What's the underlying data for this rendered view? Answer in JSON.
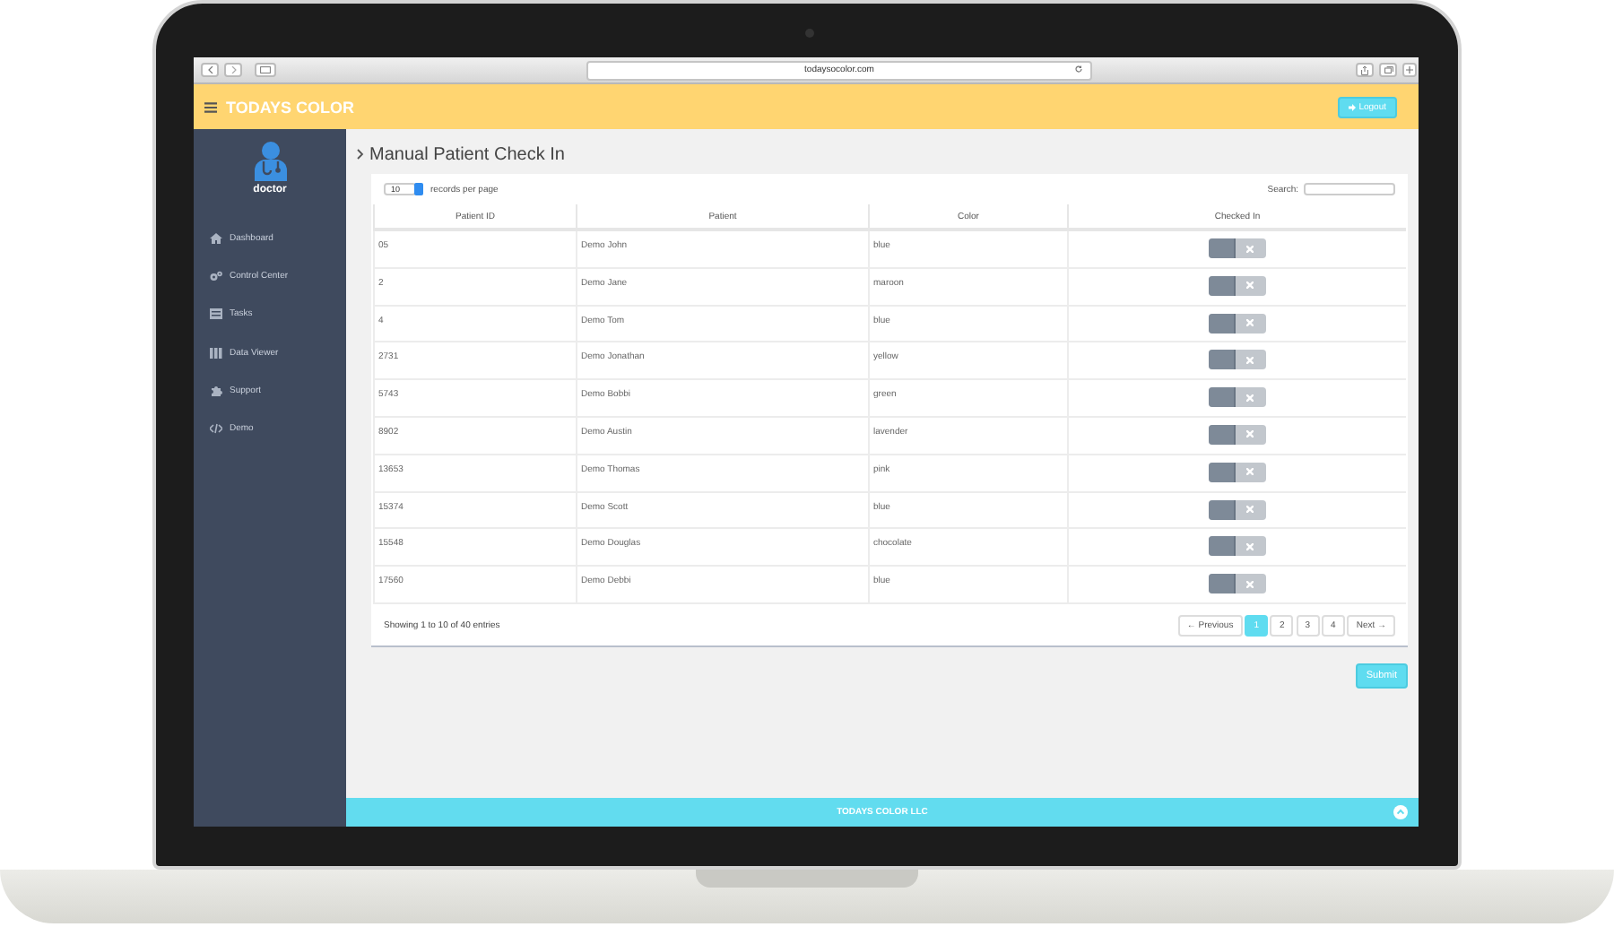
{
  "browser": {
    "url": "todaysocolor.com"
  },
  "header": {
    "brand": "TODAYS COLOR",
    "logout": "Logout"
  },
  "sidebar": {
    "user": "doctor",
    "items": [
      {
        "label": "Dashboard",
        "kind": "dashboard"
      },
      {
        "label": "Control Center",
        "kind": "gears"
      },
      {
        "label": "Tasks",
        "kind": "tasks"
      },
      {
        "label": "Data Viewer",
        "kind": "grid"
      },
      {
        "label": "Support",
        "kind": "puzzle"
      },
      {
        "label": "Demo",
        "kind": "code"
      }
    ]
  },
  "page": {
    "title": "Manual Patient Check In",
    "page_length": "10",
    "page_length_label": "records per page",
    "search_label": "Search:",
    "table": {
      "columns": [
        "Patient ID",
        "Patient",
        "Color",
        "Checked In"
      ],
      "rows": [
        {
          "id": "05",
          "patient": "Demo John",
          "color_name": "blue",
          "checked_in": false
        },
        {
          "id": "2",
          "patient": "Demo Jane",
          "color_name": "maroon",
          "checked_in": false
        },
        {
          "id": "4",
          "patient": "Demo Tom",
          "color_name": "blue",
          "checked_in": false
        },
        {
          "id": "2731",
          "patient": "Demo Jonathan",
          "color_name": "yellow",
          "checked_in": false
        },
        {
          "id": "5743",
          "patient": "Demo Bobbi",
          "color_name": "green",
          "checked_in": false
        },
        {
          "id": "8902",
          "patient": "Demo Austin",
          "color_name": "lavender",
          "checked_in": false
        },
        {
          "id": "13653",
          "patient": "Demo Thomas",
          "color_name": "pink",
          "checked_in": false
        },
        {
          "id": "15374",
          "patient": "Demo Scott",
          "color_name": "blue",
          "checked_in": false
        },
        {
          "id": "15548",
          "patient": "Demo Douglas",
          "color_name": "chocolate",
          "checked_in": false
        },
        {
          "id": "17560",
          "patient": "Demo Debbi",
          "color_name": "blue",
          "checked_in": false
        }
      ]
    },
    "info": "Showing 1 to 10 of 40 entries",
    "pagination": {
      "previous": "← Previous",
      "next": "Next →",
      "pages": [
        {
          "label": "1",
          "selected": true
        },
        {
          "label": "2",
          "selected": false
        },
        {
          "label": "3",
          "selected": false
        },
        {
          "label": "4",
          "selected": false
        }
      ]
    },
    "submit": "Submit"
  },
  "footer": {
    "text": "TODAYS COLOR LLC"
  }
}
